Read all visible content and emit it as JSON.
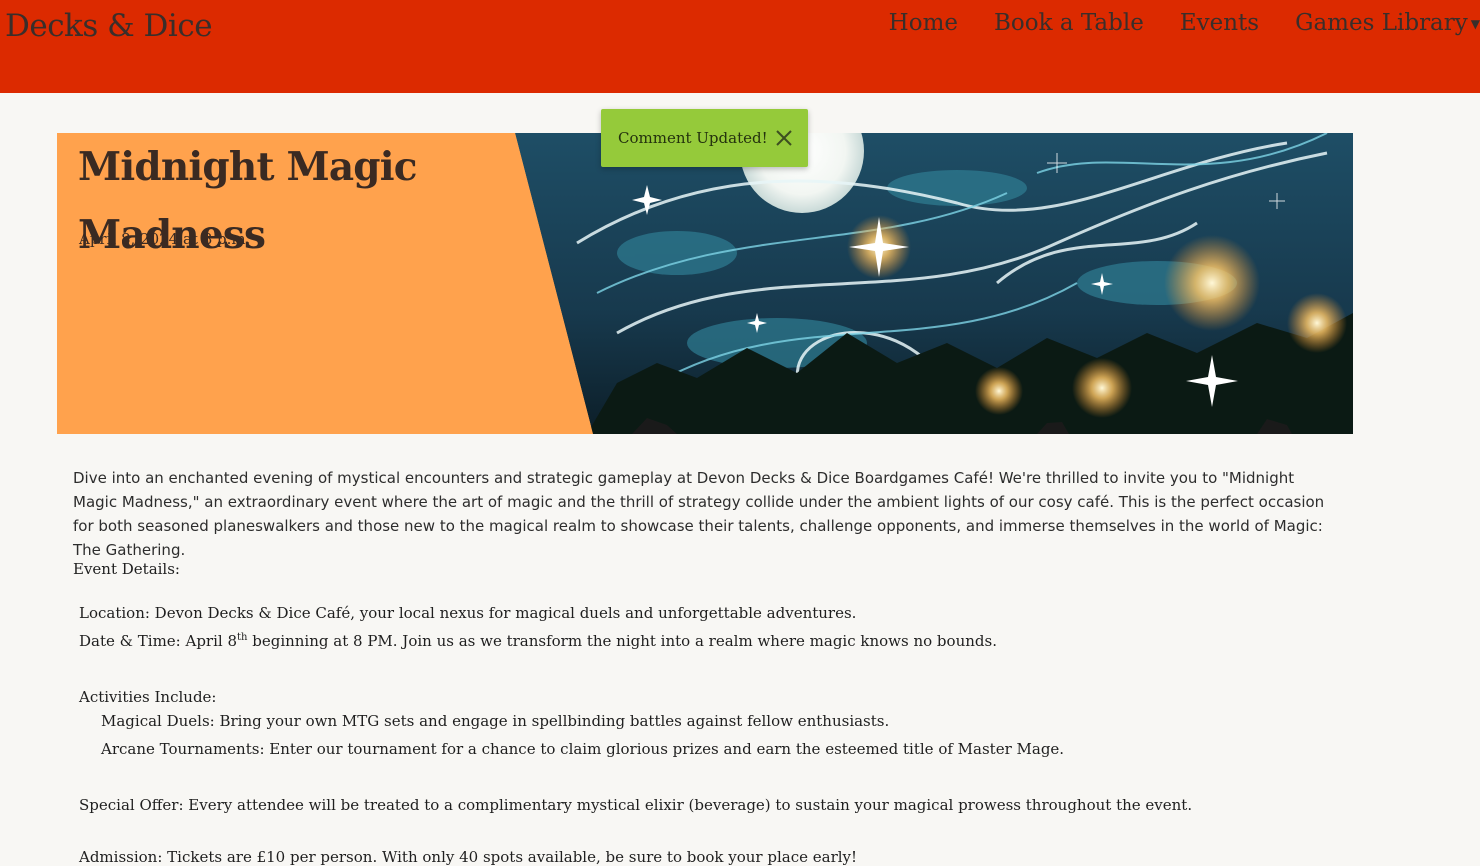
{
  "navbar": {
    "brand": "Decks & Dice",
    "links": [
      "Home",
      "Book a Table",
      "Events",
      "Games Library"
    ],
    "colors": {
      "background": "#dc2a00",
      "text": "#3a2e2a"
    }
  },
  "toast": {
    "message": "Comment Updated!",
    "close_icon": "close-icon",
    "color": "#95ca3a"
  },
  "event": {
    "title_line1": "Midnight Magic",
    "title_line2": "Madness",
    "date": "April 8, 2024 at 8 p.m.",
    "banner_color": "#ffa24d",
    "intro": "Dive into an enchanted evening of mystical encounters and strategic gameplay at Devon Decks & Dice Boardgames Café! We're thrilled to invite you to \"Midnight Magic Madness,\" an extraordinary event where the art of magic and the thrill of strategy collide under the ambient lights of our cosy café. This is the perfect occasion for both seasoned planeswalkers and those new to the magical realm to showcase their talents, challenge opponents, and immerse themselves in the world of Magic: The Gathering.",
    "details_heading": "Event Details:",
    "location": "Location: Devon Decks & Dice Café, your local nexus for magical duels and unforgettable adventures.",
    "datetime_prefix": "Date & Time: April 8",
    "datetime_sup": "th",
    "datetime_suffix": " beginning at 8 PM. Join us as we transform the night into a realm where magic knows no bounds.",
    "activities_heading": "Activities Include:",
    "activities": [
      "Magical Duels: Bring your own MTG sets and engage in spellbinding battles against fellow enthusiasts.",
      "Arcane Tournaments: Enter our tournament for a chance to claim glorious prizes and earn the esteemed title of Master Mage."
    ],
    "special_offer": "Special Offer: Every attendee will be treated to a complimentary mystical elixir (beverage) to sustain your magical prowess throughout the event.",
    "admission": "Admission: Tickets are £10 per person. With only 40 spots available, be sure to book your place early!"
  }
}
